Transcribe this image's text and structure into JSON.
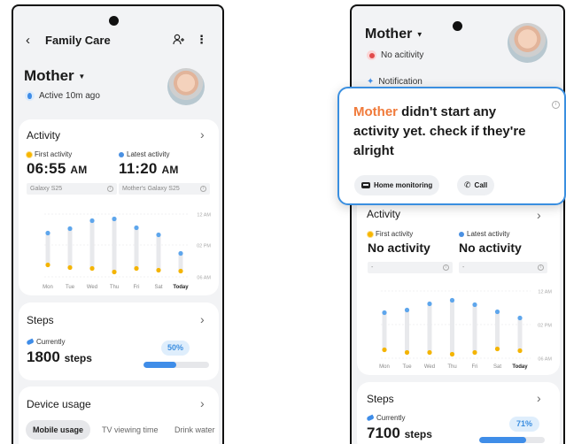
{
  "left": {
    "header": {
      "title": "Family Care"
    },
    "profile": {
      "name": "Mother",
      "status": "Active 10m ago"
    },
    "activity": {
      "title": "Activity",
      "first_label": "First activity",
      "first_time": "06:55",
      "first_ampm": "AM",
      "first_device": "Galaxy S25",
      "latest_label": "Latest activity",
      "latest_time": "11:20",
      "latest_ampm": "AM",
      "latest_device": "Mother's Galaxy S25",
      "y_labels": [
        "12 AM",
        "02 PM",
        "06 AM"
      ],
      "days": [
        "Mon",
        "Tue",
        "Wed",
        "Thu",
        "Fri",
        "Sat",
        "Today"
      ]
    },
    "steps": {
      "title": "Steps",
      "current_label": "Currently",
      "value": "1800",
      "unit": "steps",
      "percent_label": "50%",
      "percent": 50
    },
    "device_usage": {
      "title": "Device usage",
      "tabs": [
        "Mobile usage",
        "TV viewing time",
        "Drink water"
      ]
    }
  },
  "right": {
    "profile": {
      "name": "Mother",
      "status": "No acitivity",
      "notification": "Notification"
    },
    "popup": {
      "name": "Mother",
      "message": " didn't start any activity yet. check if they're alright",
      "btn_monitoring": "Home monitoring",
      "btn_call": "Call"
    },
    "activity": {
      "title": "Activity",
      "first_label": "First activity",
      "first_value": "No activity",
      "first_device": "-",
      "latest_label": "Latest activity",
      "latest_value": "No activity",
      "latest_device": "-",
      "y_labels": [
        "12 AM",
        "02 PM",
        "06 AM"
      ],
      "days": [
        "Mon",
        "Tue",
        "Wed",
        "Thu",
        "Fri",
        "Sat",
        "Today"
      ]
    },
    "steps": {
      "title": "Steps",
      "current_label": "Currently",
      "value": "7100",
      "unit": "steps",
      "percent_label": "71%",
      "percent": 71
    }
  },
  "colors": {
    "accent": "#3f8de8",
    "warning": "#f07a3a",
    "sun": "#f7b500",
    "moon": "#4a90e2"
  }
}
